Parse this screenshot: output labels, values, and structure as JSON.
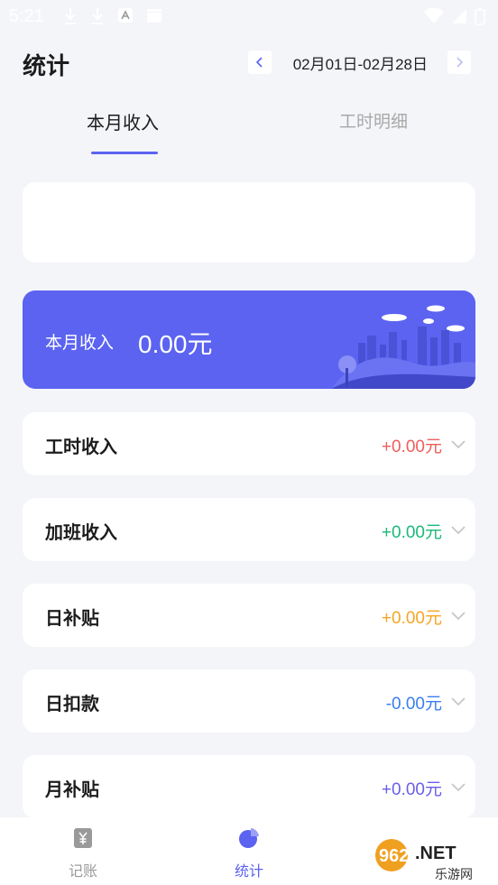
{
  "status_bar": {
    "time": "5:21"
  },
  "header": {
    "title": "统计",
    "date_range": "02月01日-02月28日"
  },
  "tabs": [
    {
      "label": "本月收入",
      "active": true
    },
    {
      "label": "工时明细",
      "active": false
    }
  ],
  "banner": {
    "label": "本月收入",
    "value": "0.00元"
  },
  "rows": [
    {
      "label": "工时收入",
      "value": "+0.00元",
      "color": "#ef5d5d"
    },
    {
      "label": "加班收入",
      "value": "+0.00元",
      "color": "#1bb87a"
    },
    {
      "label": "日补贴",
      "value": "+0.00元",
      "color": "#f5a524"
    },
    {
      "label": "日扣款",
      "value": "-0.00元",
      "color": "#3a7ef0"
    },
    {
      "label": "月补贴",
      "value": "+0.00元",
      "color": "#6a5ee8"
    }
  ],
  "tabbar": [
    {
      "label": "记账",
      "icon": "yen-receipt-icon",
      "active": false
    },
    {
      "label": "统计",
      "icon": "pie-chart-icon",
      "active": true
    }
  ],
  "colors": {
    "accent": "#5b63f0",
    "background": "#f4f5f9",
    "inactive": "#9a9a9a"
  },
  "watermark": {
    "text": "962.NET",
    "subtext": "乐游网"
  }
}
